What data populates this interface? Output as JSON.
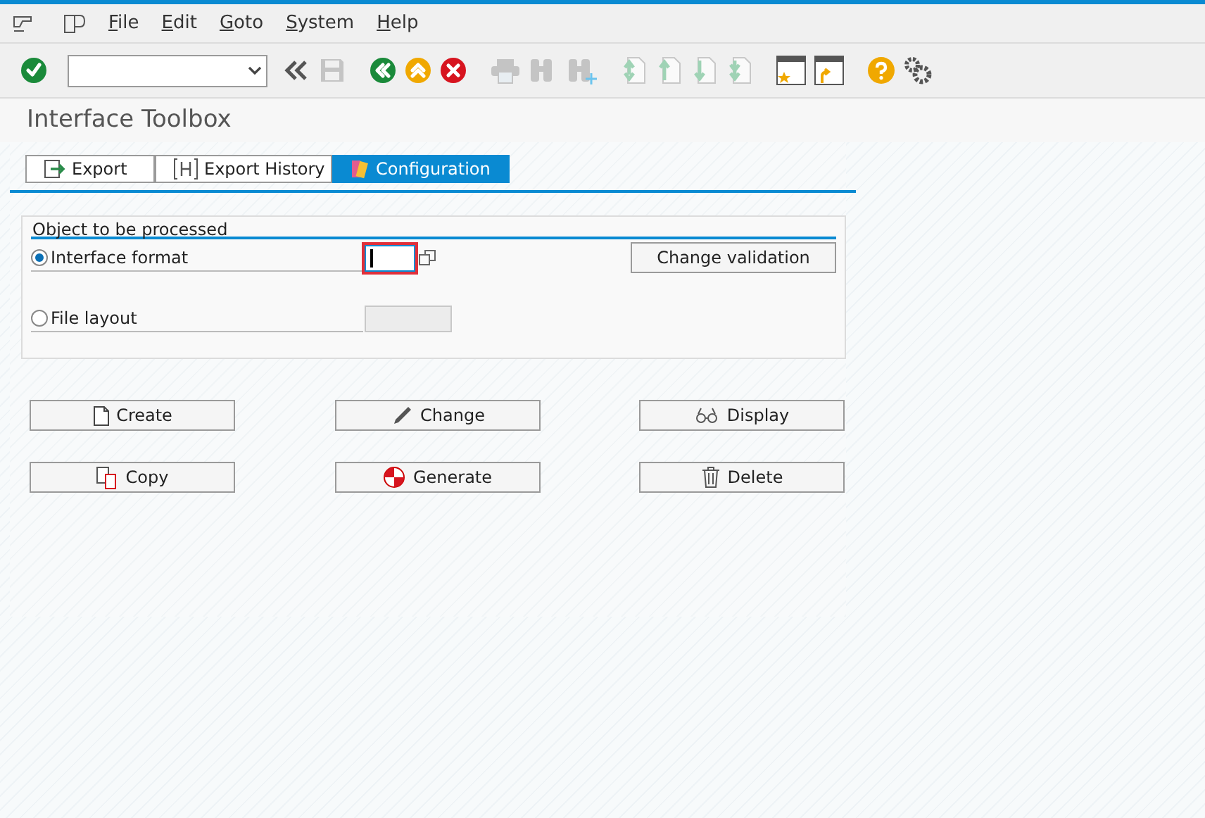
{
  "menu": [
    {
      "label": "File"
    },
    {
      "label": "Edit"
    },
    {
      "label": "Goto"
    },
    {
      "label": "System"
    },
    {
      "label": "Help"
    }
  ],
  "toolbar": [
    {
      "kind": "enter",
      "disabled": false
    },
    {
      "kind": "command_field"
    },
    {
      "kind": "collapse",
      "disabled": false
    },
    {
      "kind": "save",
      "disabled": true
    },
    {
      "kind": "back",
      "disabled": false
    },
    {
      "kind": "exit",
      "disabled": false
    },
    {
      "kind": "cancel",
      "disabled": false
    },
    {
      "kind": "print",
      "disabled": true
    },
    {
      "kind": "find",
      "disabled": true
    },
    {
      "kind": "find_next",
      "disabled": true
    },
    {
      "kind": "first_page",
      "disabled": true
    },
    {
      "kind": "prev_page",
      "disabled": true
    },
    {
      "kind": "next_page",
      "disabled": true
    },
    {
      "kind": "last_page",
      "disabled": true
    },
    {
      "kind": "new_window",
      "disabled": false
    },
    {
      "kind": "shortcut",
      "disabled": false
    },
    {
      "kind": "help",
      "disabled": false
    },
    {
      "kind": "settings",
      "disabled": false
    }
  ],
  "title": "Interface Toolbox",
  "tabs": [
    {
      "label": "Export",
      "kind": "export",
      "selected": false
    },
    {
      "label": "Export History",
      "kind": "history",
      "selected": false
    },
    {
      "label": "Configuration",
      "kind": "config",
      "selected": true
    }
  ],
  "group": {
    "title": "Object to be processed",
    "options": [
      {
        "label": "Interface format",
        "selected": true,
        "field_disabled": false,
        "focused": true
      },
      {
        "label": "File layout",
        "selected": false,
        "field_disabled": true,
        "focused": false
      }
    ],
    "button": "Change validation"
  },
  "actions": [
    {
      "label": "Create",
      "kind": "create"
    },
    {
      "label": "Change",
      "kind": "change"
    },
    {
      "label": "Display",
      "kind": "display"
    },
    {
      "label": "Copy",
      "kind": "copy"
    },
    {
      "label": "Generate",
      "kind": "generate"
    },
    {
      "label": "Delete",
      "kind": "delete"
    }
  ]
}
